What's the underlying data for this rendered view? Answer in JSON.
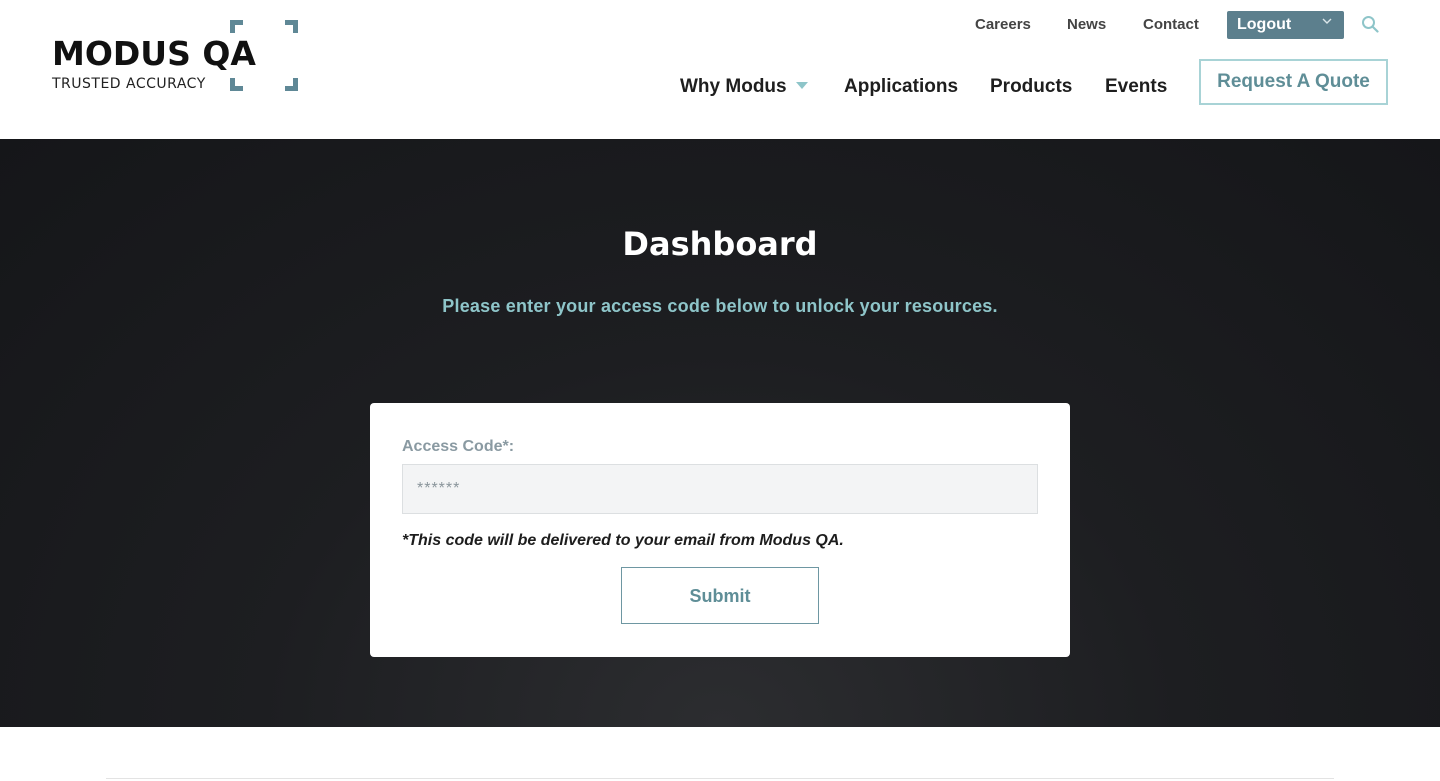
{
  "brand": {
    "name": "MODUS QA",
    "tagline": "TRUSTED ACCURACY",
    "accent_color": "#5f8896",
    "highlight_color": "#8ec5c9"
  },
  "utility_nav": {
    "careers": "Careers",
    "news": "News",
    "contact": "Contact",
    "logout": "Logout"
  },
  "main_nav": {
    "why_modus": "Why Modus",
    "applications": "Applications",
    "products": "Products",
    "events": "Events",
    "request_quote": "Request A Quote"
  },
  "hero": {
    "title": "Dashboard",
    "subtitle": "Please enter your access code below to unlock your resources."
  },
  "access_form": {
    "label": "Access Code*:",
    "placeholder": "******",
    "value": "",
    "note": "*This code will be delivered to your email from Modus QA.",
    "submit_label": "Submit"
  }
}
